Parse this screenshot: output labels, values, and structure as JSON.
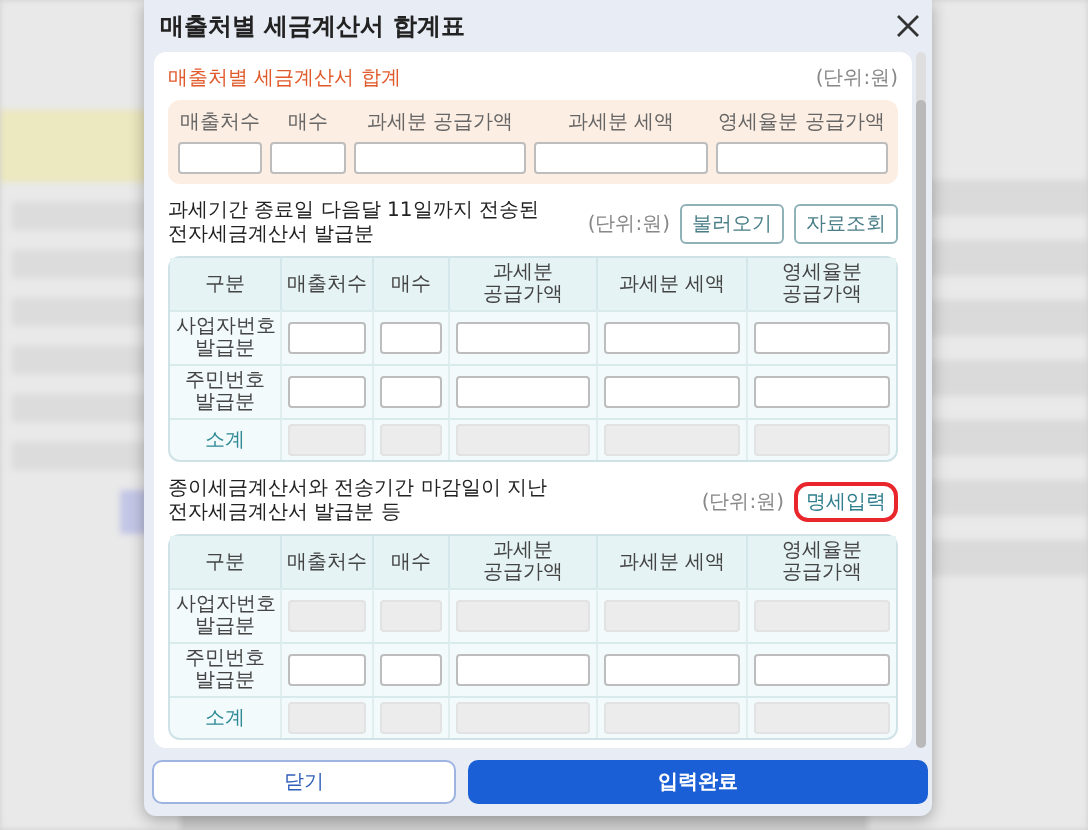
{
  "dialog": {
    "title": "매출처별 세금계산서 합계표"
  },
  "summary": {
    "title": "매출처별 세금계산서 합계",
    "unit": "(단위:원)",
    "columns": [
      "매출처수",
      "매수",
      "과세분 공급가액",
      "과세분 세액",
      "영세율분 공급가액"
    ]
  },
  "sections": [
    {
      "title": "과세기간 종료일 다음달 11일까지 전송된 전자세금계산서 발급분",
      "unit": "(단위:원)",
      "buttons": [
        {
          "label": "불러오기",
          "highlighted": false
        },
        {
          "label": "자료조회",
          "highlighted": false
        }
      ],
      "columns": [
        "구분",
        "매출처수",
        "매수",
        "과세분 공급가액",
        "과세분 세액",
        "영세율분 공급가액"
      ],
      "rows": [
        {
          "label": "사업자번호 발급분",
          "kind": "entry",
          "disabled": false
        },
        {
          "label": "주민번호 발급분",
          "kind": "entry",
          "disabled": false
        },
        {
          "label": "소계",
          "kind": "subtotal",
          "disabled": true
        }
      ]
    },
    {
      "title": "종이세금계산서와 전송기간 마감일이 지난 전자세금계산서 발급분 등",
      "unit": "(단위:원)",
      "buttons": [
        {
          "label": "명세입력",
          "highlighted": true
        }
      ],
      "columns": [
        "구분",
        "매출처수",
        "매수",
        "과세분 공급가액",
        "과세분 세액",
        "영세율분 공급가액"
      ],
      "rows": [
        {
          "label": "사업자번호 발급분",
          "kind": "entry",
          "disabled": true
        },
        {
          "label": "주민번호 발급분",
          "kind": "entry",
          "disabled": false
        },
        {
          "label": "소계",
          "kind": "subtotal",
          "disabled": true
        }
      ]
    }
  ],
  "footer": {
    "buttons": [
      {
        "label": "닫기",
        "kind": "secondary"
      },
      {
        "label": "입력완료",
        "kind": "primary"
      }
    ]
  }
}
